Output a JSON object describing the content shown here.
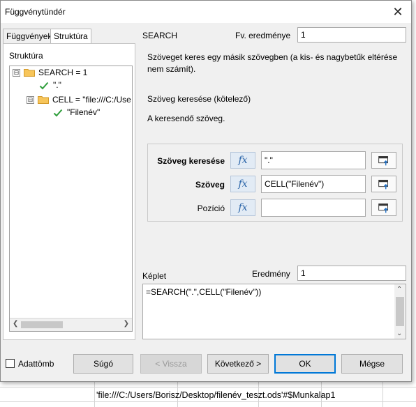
{
  "dialog": {
    "title": "Függvénytündér",
    "close_glyph": "✕"
  },
  "tabs": [
    {
      "label": "Függvények"
    },
    {
      "label": "Struktúra"
    }
  ],
  "structure": {
    "label": "Struktúra",
    "tree": [
      {
        "text": "SEARCH = 1",
        "icon": "folder-icon",
        "expander": "⊟"
      },
      {
        "text": "\".\"",
        "icon": "check-icon"
      },
      {
        "text": "CELL = \"file:///C:/Use",
        "icon": "folder-icon",
        "expander": "⊟"
      },
      {
        "text": "\"Filenév\"",
        "icon": "check-icon"
      }
    ]
  },
  "function": {
    "name": "SEARCH",
    "result_label": "Fv. eredménye",
    "result_value": "1",
    "description": "Szöveget keres egy másik szövegben (a kis- és nagybetűk eltérése nem számít).",
    "arg_title": "Szöveg keresése (kötelező)",
    "arg_desc": "A keresendő szöveg."
  },
  "args": [
    {
      "label": "Szöveg keresése",
      "value": "\".\"",
      "bold": true
    },
    {
      "label": "Szöveg",
      "value": "CELL(\"Filenév\")",
      "bold": true
    },
    {
      "label": "Pozíció",
      "value": "",
      "bold": false
    }
  ],
  "formula": {
    "label": "Képlet",
    "result_label": "Eredmény",
    "result_value": "1",
    "text": "=SEARCH(\".\",CELL(\"Filenév\"))"
  },
  "footer": {
    "array_label": "Adattömb",
    "help": "Súgó",
    "back": "< Vissza",
    "next": "Következő >",
    "ok": "OK",
    "cancel": "Mégse"
  },
  "sheet": {
    "cell_text": "'file:///C:/Users/Borisz/Desktop/filenév_teszt.ods'#$Munkalap1"
  }
}
